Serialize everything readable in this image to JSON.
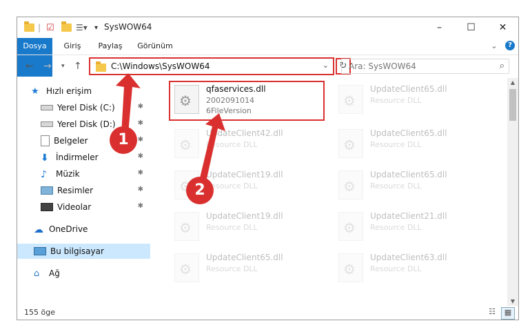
{
  "window": {
    "title": "SysWOW64",
    "controls": {
      "minimize": "–",
      "maximize": "☐",
      "close": "✕"
    }
  },
  "ribbon": {
    "tabs": [
      "Dosya",
      "Giriş",
      "Paylaş",
      "Görünüm"
    ],
    "expand": "⌄",
    "help": "?"
  },
  "addressbar": {
    "path": "C:\\Windows\\SysWOW64",
    "search_placeholder": "Ara: SysWOW64"
  },
  "navigation": {
    "items": [
      {
        "label": "Hızlı erişim",
        "icon": "star-icon",
        "pinned": false
      },
      {
        "label": "Yerel Disk (C:)",
        "icon": "drive-icon",
        "pinned": true
      },
      {
        "label": "Yerel Disk (D:)",
        "icon": "drive-icon",
        "pinned": true
      },
      {
        "label": "Belgeler",
        "icon": "document-icon",
        "pinned": true
      },
      {
        "label": "İndirmeler",
        "icon": "download-icon",
        "pinned": true
      },
      {
        "label": "Müzik",
        "icon": "music-icon",
        "pinned": true
      },
      {
        "label": "Resimler",
        "icon": "picture-icon",
        "pinned": true
      },
      {
        "label": "Videolar",
        "icon": "video-icon",
        "pinned": true
      },
      {
        "label": "OneDrive",
        "icon": "cloud-icon",
        "pinned": false
      },
      {
        "label": "Bu bilgisayar",
        "icon": "computer-icon",
        "pinned": false
      },
      {
        "label": "Ağ",
        "icon": "network-icon",
        "pinned": false
      }
    ]
  },
  "files": [
    {
      "name": "qfaservices.dll",
      "line2": "2002091014",
      "line3": "6FileVersion",
      "highlight": true
    },
    {
      "name": "UpdateClient65.dll",
      "line2": "Resource DLL",
      "line3": ""
    },
    {
      "name": "UpdateClient42.dll",
      "line2": "Resource DLL",
      "line3": ""
    },
    {
      "name": "UpdateClient65.dll",
      "line2": "Resource DLL",
      "line3": ""
    },
    {
      "name": "UpdateClient19.dll",
      "line2": "Resource DLL",
      "line3": ""
    },
    {
      "name": "UpdateClient65.dll",
      "line2": "Resource DLL",
      "line3": ""
    },
    {
      "name": "UpdateClient19.dll",
      "line2": "Resource DLL",
      "line3": ""
    },
    {
      "name": "UpdateClient21.dll",
      "line2": "Resource DLL",
      "line3": ""
    },
    {
      "name": "UpdateClient65.dll",
      "line2": "Resource DLL",
      "line3": ""
    },
    {
      "name": "UpdateClient63.dll",
      "line2": "Resource DLL",
      "line3": ""
    }
  ],
  "status": {
    "count": "155 öge"
  },
  "annotations": {
    "step1": "1",
    "step2": "2",
    "color": "#d9302f"
  }
}
